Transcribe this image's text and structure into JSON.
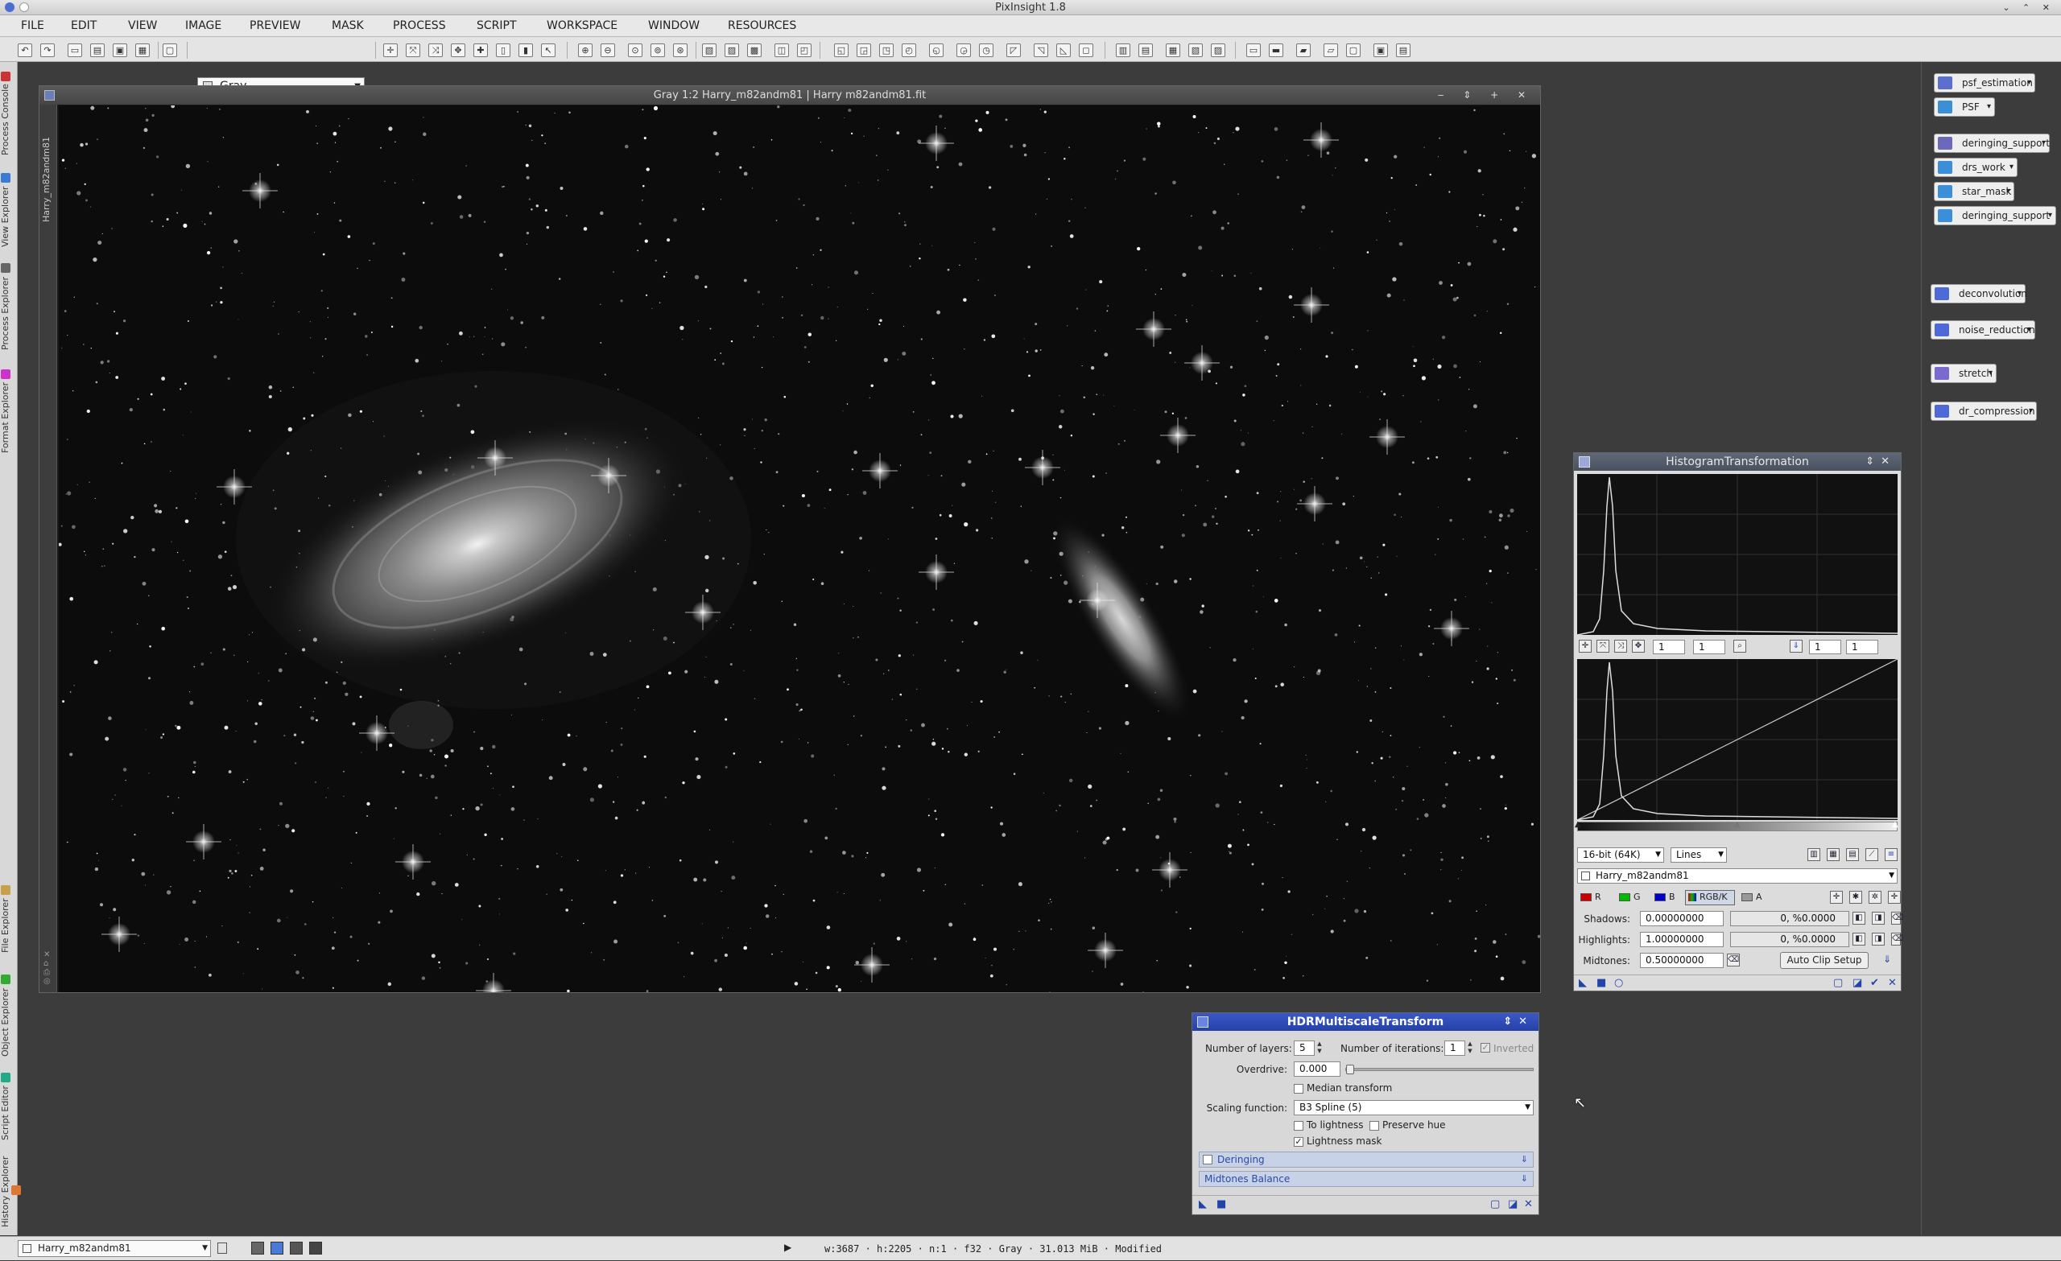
{
  "app": {
    "title": "PixInsight 1.8"
  },
  "menu": [
    "FILE",
    "EDIT",
    "VIEW",
    "IMAGE",
    "PREVIEW",
    "MASK",
    "PROCESS",
    "SCRIPT",
    "WORKSPACE",
    "WINDOW",
    "RESOURCES"
  ],
  "toolbar": {
    "color_space": "Gray"
  },
  "left_tabs": [
    "Process Console",
    "View Explorer",
    "Process Explorer",
    "Format Explorer",
    "File Explorer",
    "Object Explorer",
    "Script Editor",
    "History Explorer"
  ],
  "process_icons": {
    "group1": [
      "psf_estimation",
      "PSF"
    ],
    "group2": [
      "deringing_support",
      "drs_work",
      "star_mask",
      "deringing_support"
    ],
    "group3": [
      "deconvolution",
      "noise_reduction",
      "stretch",
      "dr_compression"
    ]
  },
  "image_window": {
    "title": "Gray 1:2 Harry_m82andm81 | Harry m82andm81.fit",
    "side_label": "Harry_m82andm81"
  },
  "histogram": {
    "title": "HistogramTransformation",
    "zoom_h": "1",
    "zoom_v": "1",
    "zoom_h2": "1",
    "zoom_v2": "1",
    "resolution": "16-bit (64K)",
    "graph_style": "Lines",
    "view": "Harry_m82andm81",
    "channels": [
      "R",
      "G",
      "B",
      "RGB/K",
      "A"
    ],
    "shadows_label": "Shadows:",
    "shadows": "0.00000000",
    "shadows_clip": "0, %0.0000",
    "highlights_label": "Highlights:",
    "highlights": "1.00000000",
    "highlights_clip": "0, %0.0000",
    "midtones_label": "Midtones:",
    "midtones": "0.50000000",
    "auto_clip": "Auto Clip Setup"
  },
  "hdr": {
    "title": "HDRMultiscaleTransform",
    "layers_label": "Number of layers:",
    "layers": "5",
    "iterations_label": "Number of iterations:",
    "iterations": "1",
    "inverted": "Inverted",
    "overdrive_label": "Overdrive:",
    "overdrive": "0.000",
    "overdrive_level": 0.0,
    "median": "Median transform",
    "scaling_label": "Scaling function:",
    "scaling": "B3 Spline (5)",
    "to_lightness": "To lightness",
    "preserve_hue": "Preserve hue",
    "lightness_mask": "Lightness mask",
    "deringing": "Deringing",
    "midtones_balance": "Midtones Balance"
  },
  "status": {
    "view": "Harry_m82andm81",
    "info": "w:3687 · h:2205 · n:1 · f32 · Gray · 31.013 MiB · Modified"
  }
}
